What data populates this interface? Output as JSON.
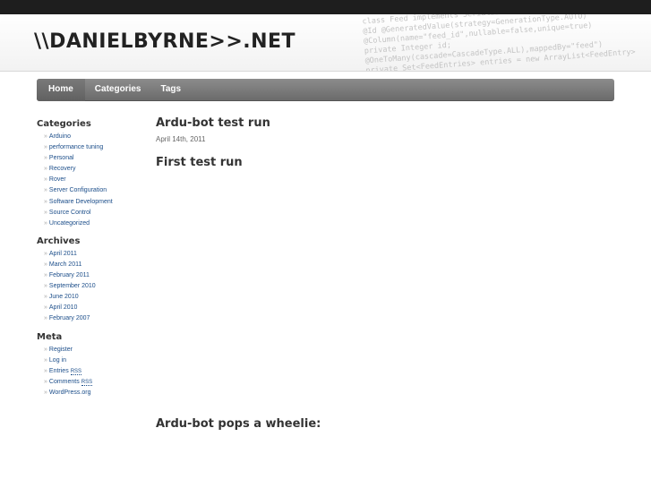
{
  "site": {
    "logo_text": "\\\\DANIELBYRNE>>.NET",
    "header_code_lines": [
      "class Feed implements Serializable {",
      "@Id @GeneratedValue(strategy=GenerationType.AUTO)",
      "@Column(name=\"feed_id\",nullable=false,unique=true)",
      "private Integer id;",
      "@OneToMany(cascade=CascadeType.ALL),mappedBy=\"feed\")",
      "private Set<FeedEntries> entries = new ArrayList<FeedEntry>"
    ]
  },
  "nav": {
    "items": [
      {
        "label": "Home",
        "active": true
      },
      {
        "label": "Categories",
        "active": false
      },
      {
        "label": "Tags",
        "active": false
      }
    ]
  },
  "sidebar": {
    "categories_heading": "Categories",
    "categories": [
      "Arduino",
      "performance tuning",
      "Personal",
      "Recovery",
      "Rover",
      "Server Configuration",
      "Software Development",
      "Source Control",
      "Uncategorized"
    ],
    "archives_heading": "Archives",
    "archives": [
      "April 2011",
      "March 2011",
      "February 2011",
      "September 2010",
      "June 2010",
      "April 2010",
      "February 2007"
    ],
    "meta_heading": "Meta",
    "meta": [
      {
        "label": "Register",
        "rss": ""
      },
      {
        "label": "Log in",
        "rss": ""
      },
      {
        "label": "Entries",
        "rss": "RSS"
      },
      {
        "label": "Comments",
        "rss": "RSS"
      },
      {
        "label": "WordPress.org",
        "rss": ""
      }
    ],
    "bullet": "»"
  },
  "post": {
    "title": "Ardu-bot test run",
    "date": "April 14th, 2011",
    "heading_1": "First test run",
    "heading_2": "Ardu-bot pops a wheelie:"
  },
  "colors": {
    "link": "#1c4e8a",
    "nav_bg": "#7a7a7a",
    "topbar": "#1e1e1e"
  }
}
